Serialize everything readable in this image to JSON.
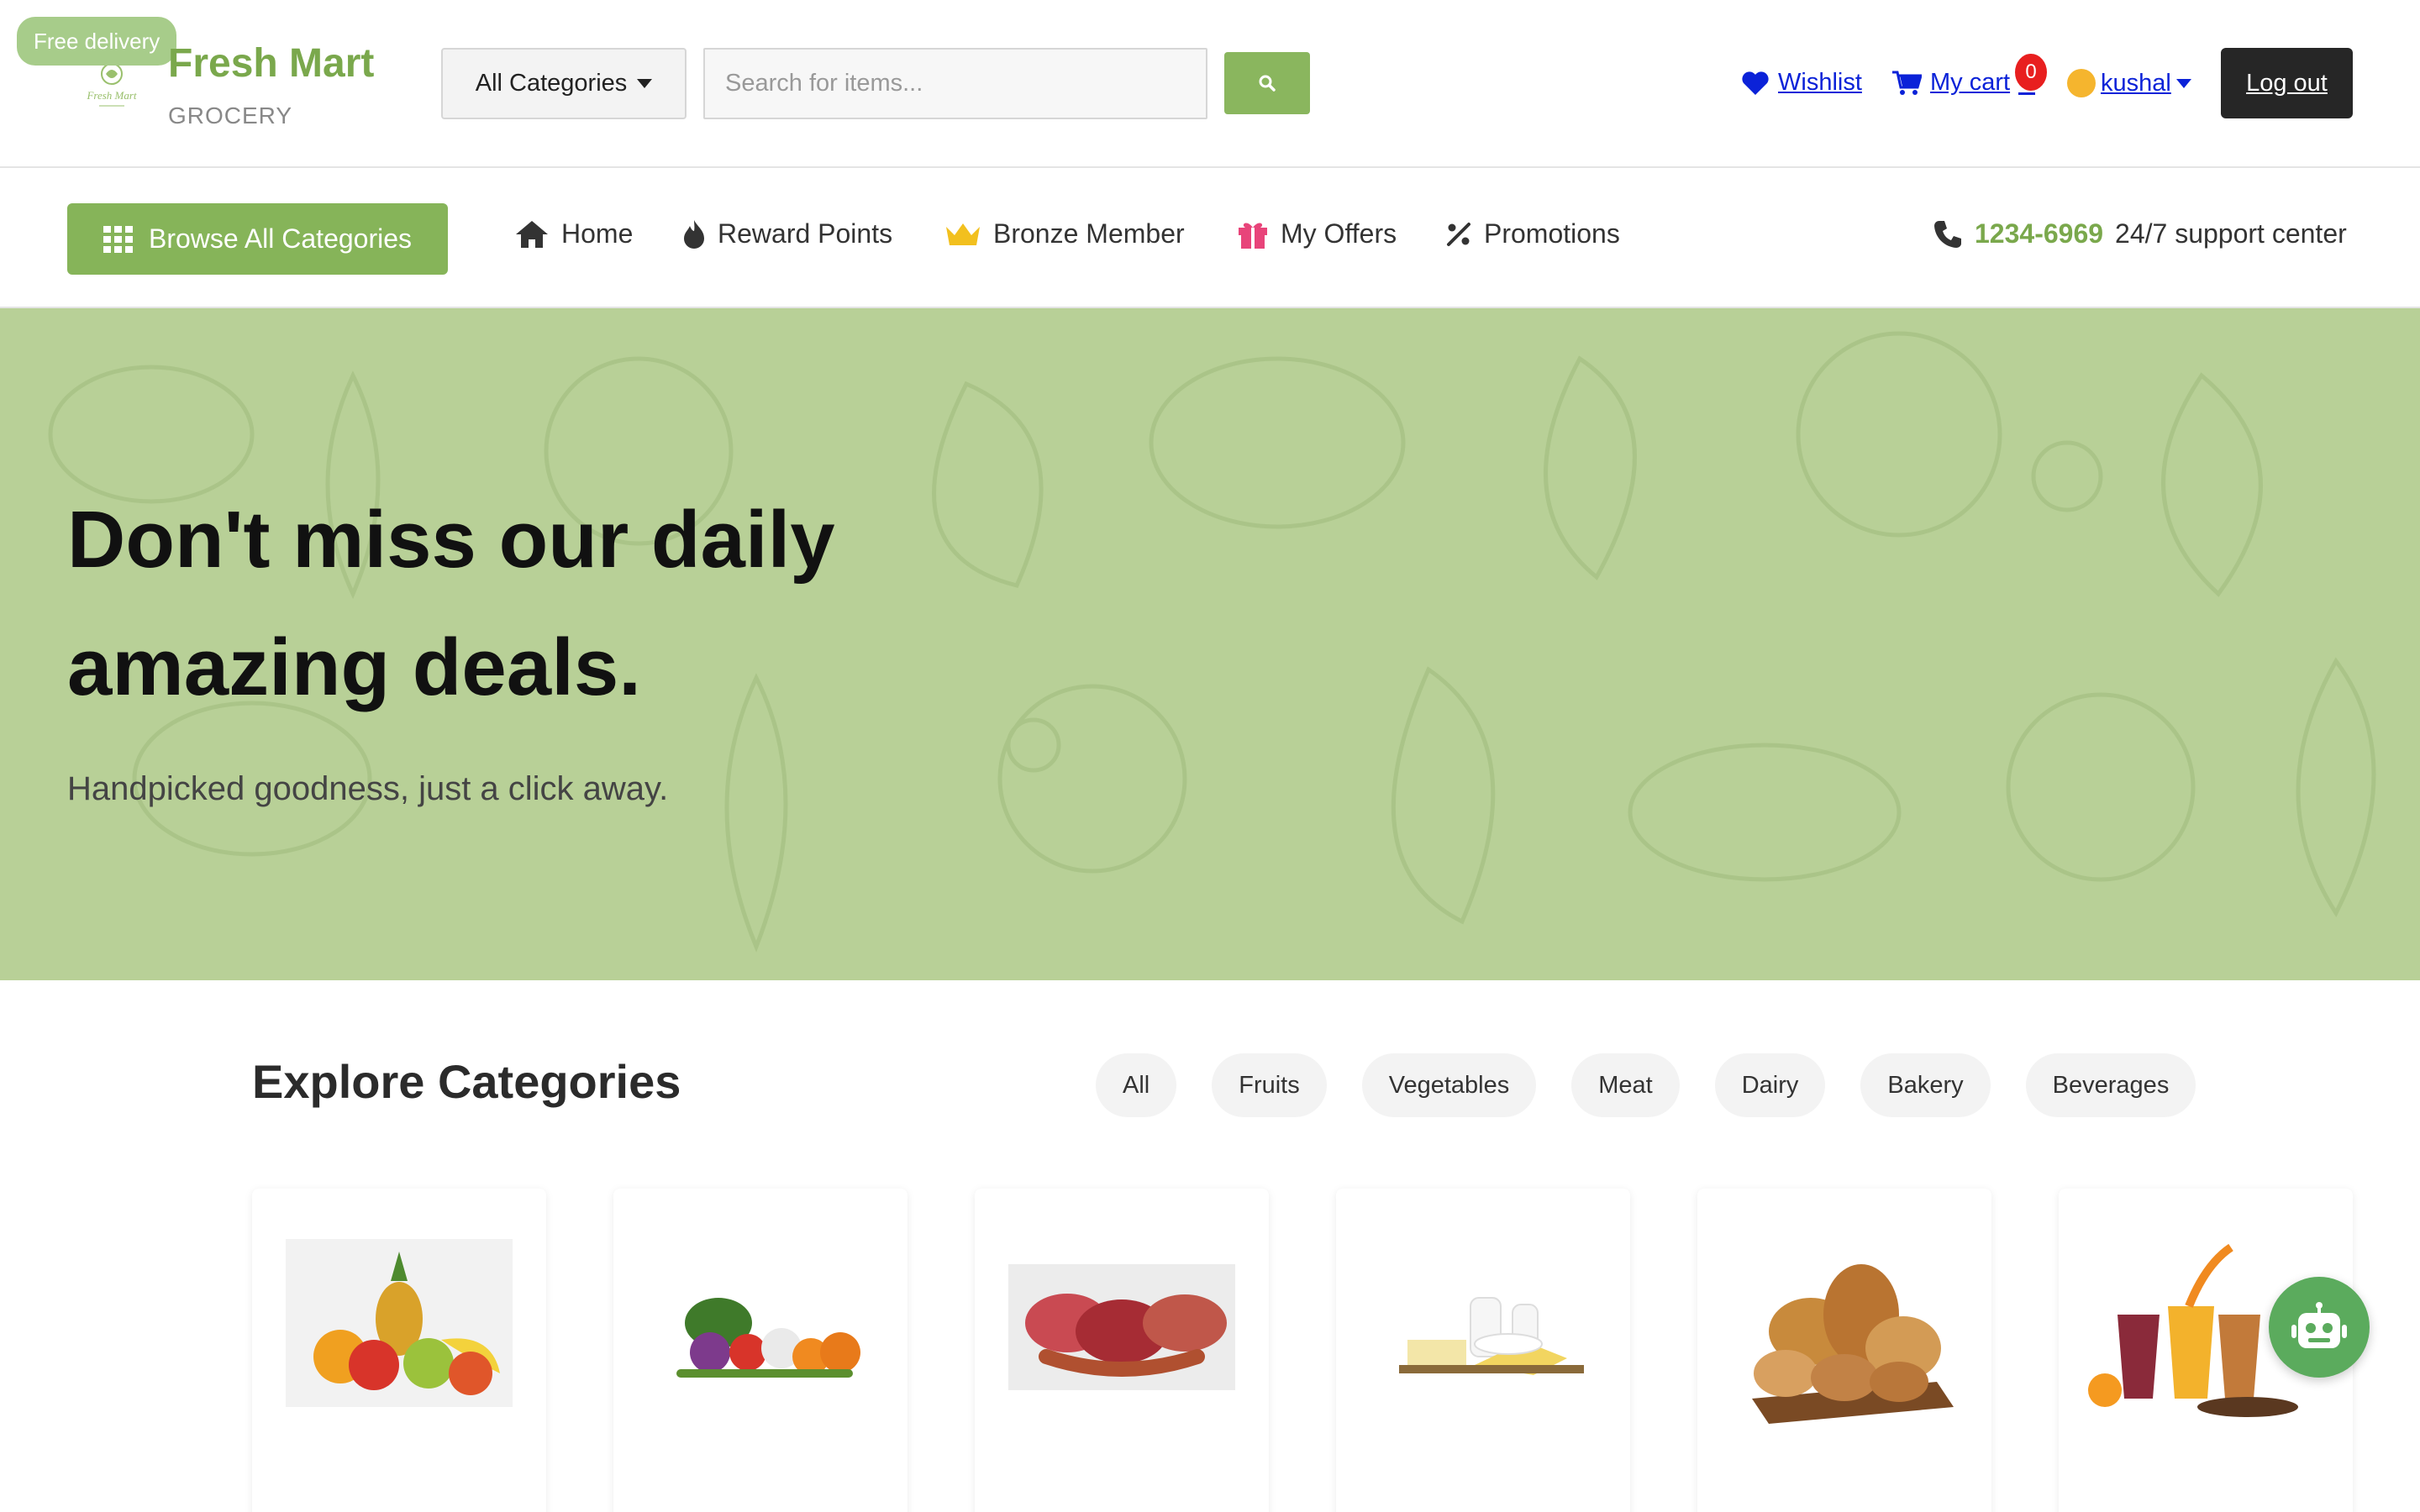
{
  "header": {
    "free_delivery": "Free delivery",
    "brand_name": "Fresh Mart",
    "brand_sub": "GROCERY",
    "logo_text": "Fresh Mart",
    "category_select": "All Categories",
    "search_placeholder": "Search for items...",
    "wishlist": "Wishlist",
    "cart": "My cart",
    "cart_count": "0",
    "user": "kushal",
    "logout": "Log out"
  },
  "nav": {
    "browse": "Browse All Categories",
    "items": [
      {
        "label": "Home",
        "icon": "home-icon"
      },
      {
        "label": "Reward Points",
        "icon": "flame-icon"
      },
      {
        "label": "Bronze Member",
        "icon": "crown-icon"
      },
      {
        "label": "My Offers",
        "icon": "gift-icon"
      },
      {
        "label": "Promotions",
        "icon": "percent-icon"
      }
    ],
    "phone": "1234-6969",
    "support": "24/7 support center"
  },
  "hero": {
    "title": "Don't miss our daily amazing deals.",
    "subtitle": "Handpicked goodness, just a click away."
  },
  "categories": {
    "title": "Explore Categories",
    "chips": [
      "All",
      "Fruits",
      "Vegetables",
      "Meat",
      "Dairy",
      "Bakery",
      "Beverages"
    ],
    "cards": [
      "fruits-image",
      "vegetables-image",
      "meat-image",
      "dairy-image",
      "bakery-image",
      "beverages-image"
    ]
  },
  "colors": {
    "brand_green": "#7aa84c",
    "hero_bg": "#b8d097",
    "link_blue": "#0b22d8",
    "badge_red": "#e81f1f"
  }
}
